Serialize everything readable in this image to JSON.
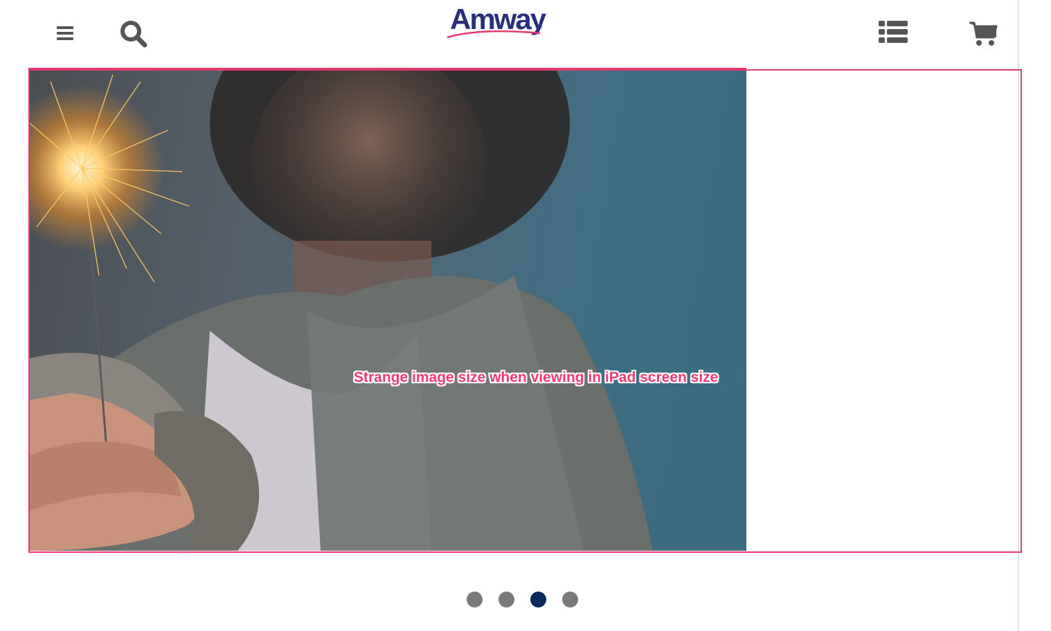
{
  "header": {
    "logo_text": "Amway",
    "logo_mark": "®",
    "icons": {
      "menu": "hamburger-menu-icon",
      "search": "search-icon",
      "list": "list-view-icon",
      "cart": "shopping-cart-icon"
    }
  },
  "carousel": {
    "annotation": "Strange image size when viewing in iPad screen size",
    "dots": [
      {
        "active": false
      },
      {
        "active": false
      },
      {
        "active": true
      },
      {
        "active": false
      }
    ]
  },
  "colors": {
    "icon_gray": "#555555",
    "brand_blue": "#2b2f7a",
    "brand_pink": "#e8366e",
    "dot_active": "#0b2a5b",
    "dot_inactive": "#7a7a7a"
  }
}
